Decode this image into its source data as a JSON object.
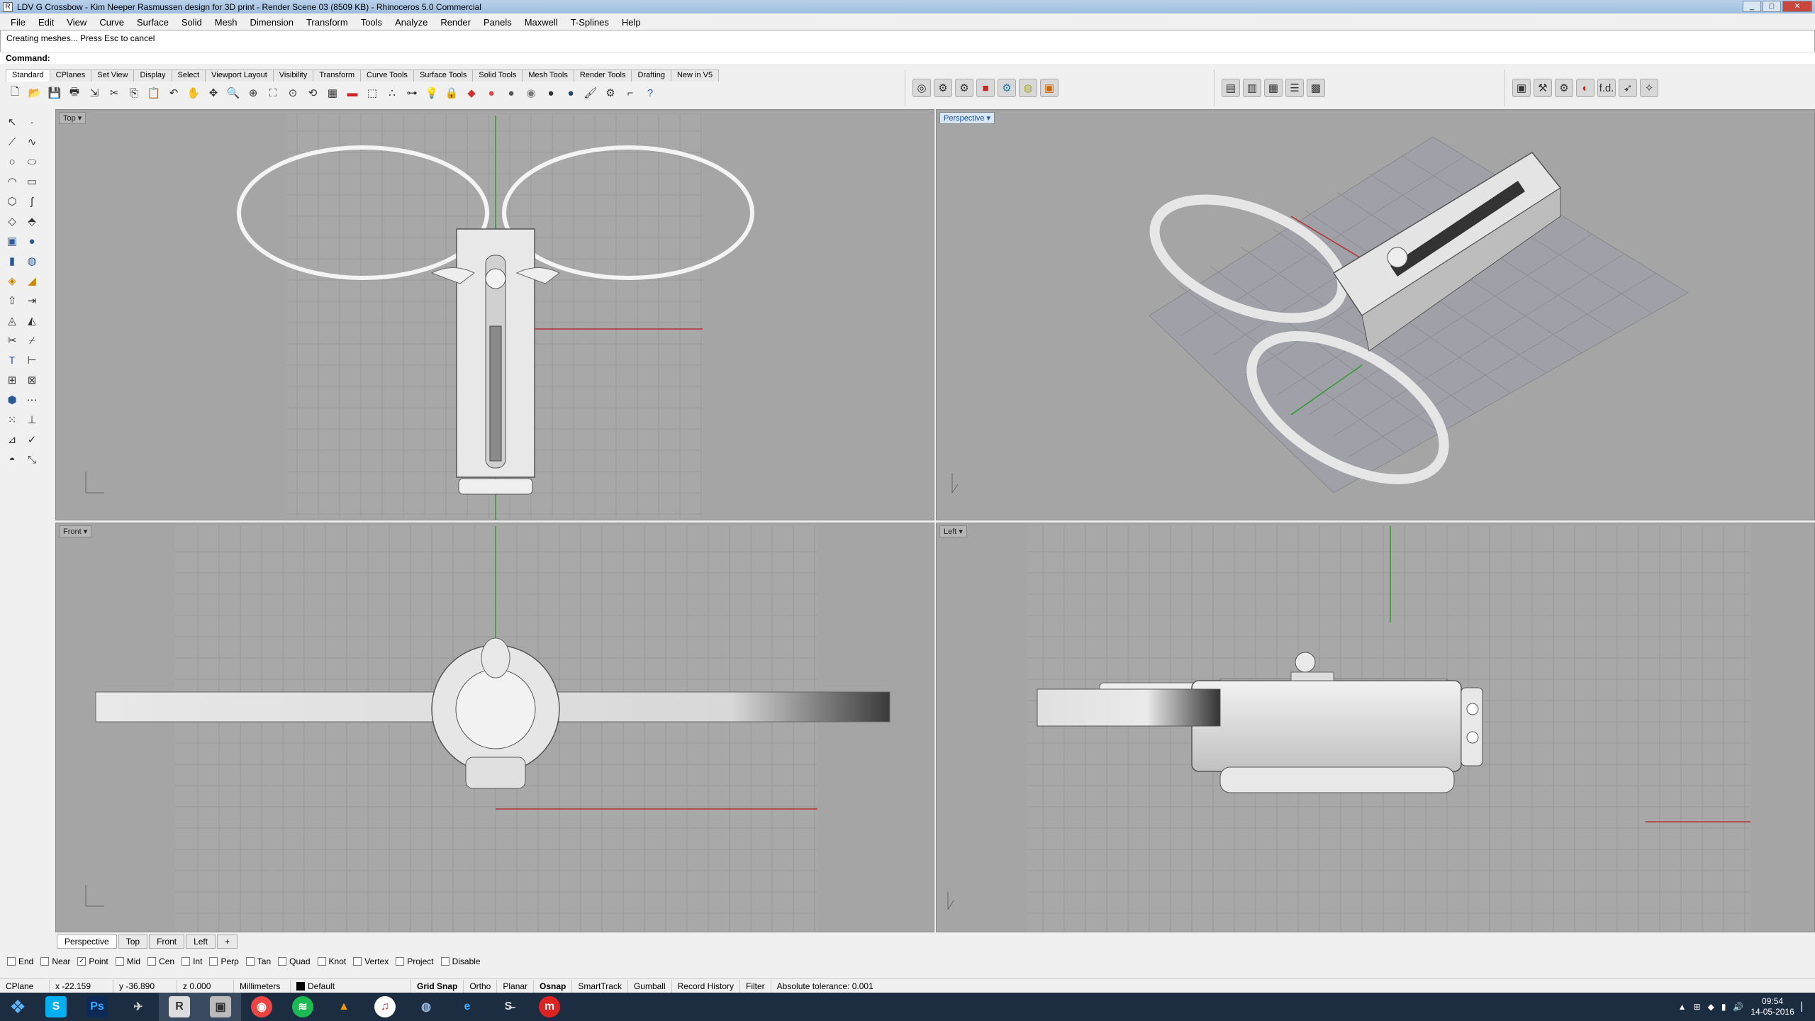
{
  "window": {
    "title": "LDV G Crossbow - Kim Neeper Rasmussen design for 3D print - Render Scene 03 (8509 KB) - Rhinoceros 5.0 Commercial"
  },
  "menu": [
    "File",
    "Edit",
    "View",
    "Curve",
    "Surface",
    "Solid",
    "Mesh",
    "Dimension",
    "Transform",
    "Tools",
    "Analyze",
    "Render",
    "Panels",
    "Maxwell",
    "T-Splines",
    "Help"
  ],
  "command": {
    "history": "Creating meshes... Press Esc to cancel",
    "prompt": "Command:"
  },
  "toolbar_tabs": [
    "Standard",
    "CPlanes",
    "Set View",
    "Display",
    "Select",
    "Viewport Layout",
    "Visibility",
    "Transform",
    "Curve Tools",
    "Surface Tools",
    "Solid Tools",
    "Mesh Tools",
    "Render Tools",
    "Drafting",
    "New in V5"
  ],
  "viewports": {
    "top": "Top",
    "perspective": "Perspective",
    "front": "Front",
    "left": "Left"
  },
  "viewport_tabs": [
    "Perspective",
    "Top",
    "Front",
    "Left"
  ],
  "osnaps": [
    {
      "label": "End",
      "checked": false
    },
    {
      "label": "Near",
      "checked": false
    },
    {
      "label": "Point",
      "checked": true
    },
    {
      "label": "Mid",
      "checked": false
    },
    {
      "label": "Cen",
      "checked": false
    },
    {
      "label": "Int",
      "checked": false
    },
    {
      "label": "Perp",
      "checked": false
    },
    {
      "label": "Tan",
      "checked": false
    },
    {
      "label": "Quad",
      "checked": false
    },
    {
      "label": "Knot",
      "checked": false
    },
    {
      "label": "Vertex",
      "checked": false
    },
    {
      "label": "Project",
      "checked": false
    },
    {
      "label": "Disable",
      "checked": false
    }
  ],
  "status": {
    "cplane": "CPlane",
    "x": "x -22.159",
    "y": "y -36.890",
    "z": "z 0.000",
    "units": "Millimeters",
    "layer": "Default",
    "grid_snap": "Grid Snap",
    "ortho": "Ortho",
    "planar": "Planar",
    "osnap": "Osnap",
    "smarttrack": "SmartTrack",
    "gumball": "Gumball",
    "record_history": "Record History",
    "filter": "Filter",
    "tolerance": "Absolute tolerance: 0.001"
  },
  "taskbar": {
    "time": "09:54",
    "date": "14-05-2016"
  },
  "colors": {
    "viewport_bg": "#a5a5a5",
    "grid": "#999999",
    "x_axis": "#b43232",
    "y_axis": "#2e9a2e"
  }
}
